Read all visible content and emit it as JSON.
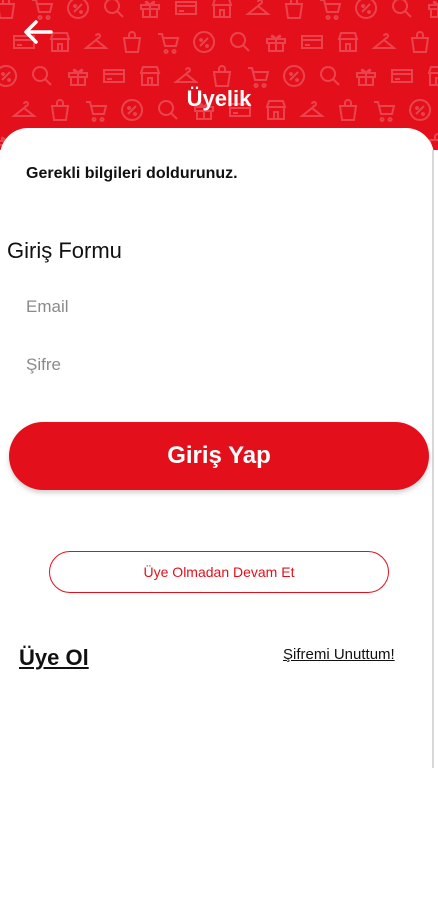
{
  "header": {
    "title": "Üyelik",
    "back_icon": "arrow-left-icon",
    "background_color": "#e3101b",
    "pattern_icons": [
      "shopping-bag-icon",
      "shopping-cart-icon",
      "percent-tag-icon",
      "search-icon",
      "gift-icon",
      "credit-card-icon",
      "store-icon",
      "hanger-icon"
    ]
  },
  "main": {
    "instructions": "Gerekli bilgileri doldurunuz.",
    "form_title": "Giriş Formu",
    "email_placeholder": "Email",
    "password_placeholder": "Şifre",
    "login_button": "Giriş Yap",
    "guest_button": "Üye Olmadan Devam Et",
    "register_link": "Üye Ol",
    "forgot_link": "Şifremi Unuttum!"
  },
  "colors": {
    "accent": "#e3101b",
    "text": "#111111",
    "placeholder": "#8a8a8a"
  }
}
